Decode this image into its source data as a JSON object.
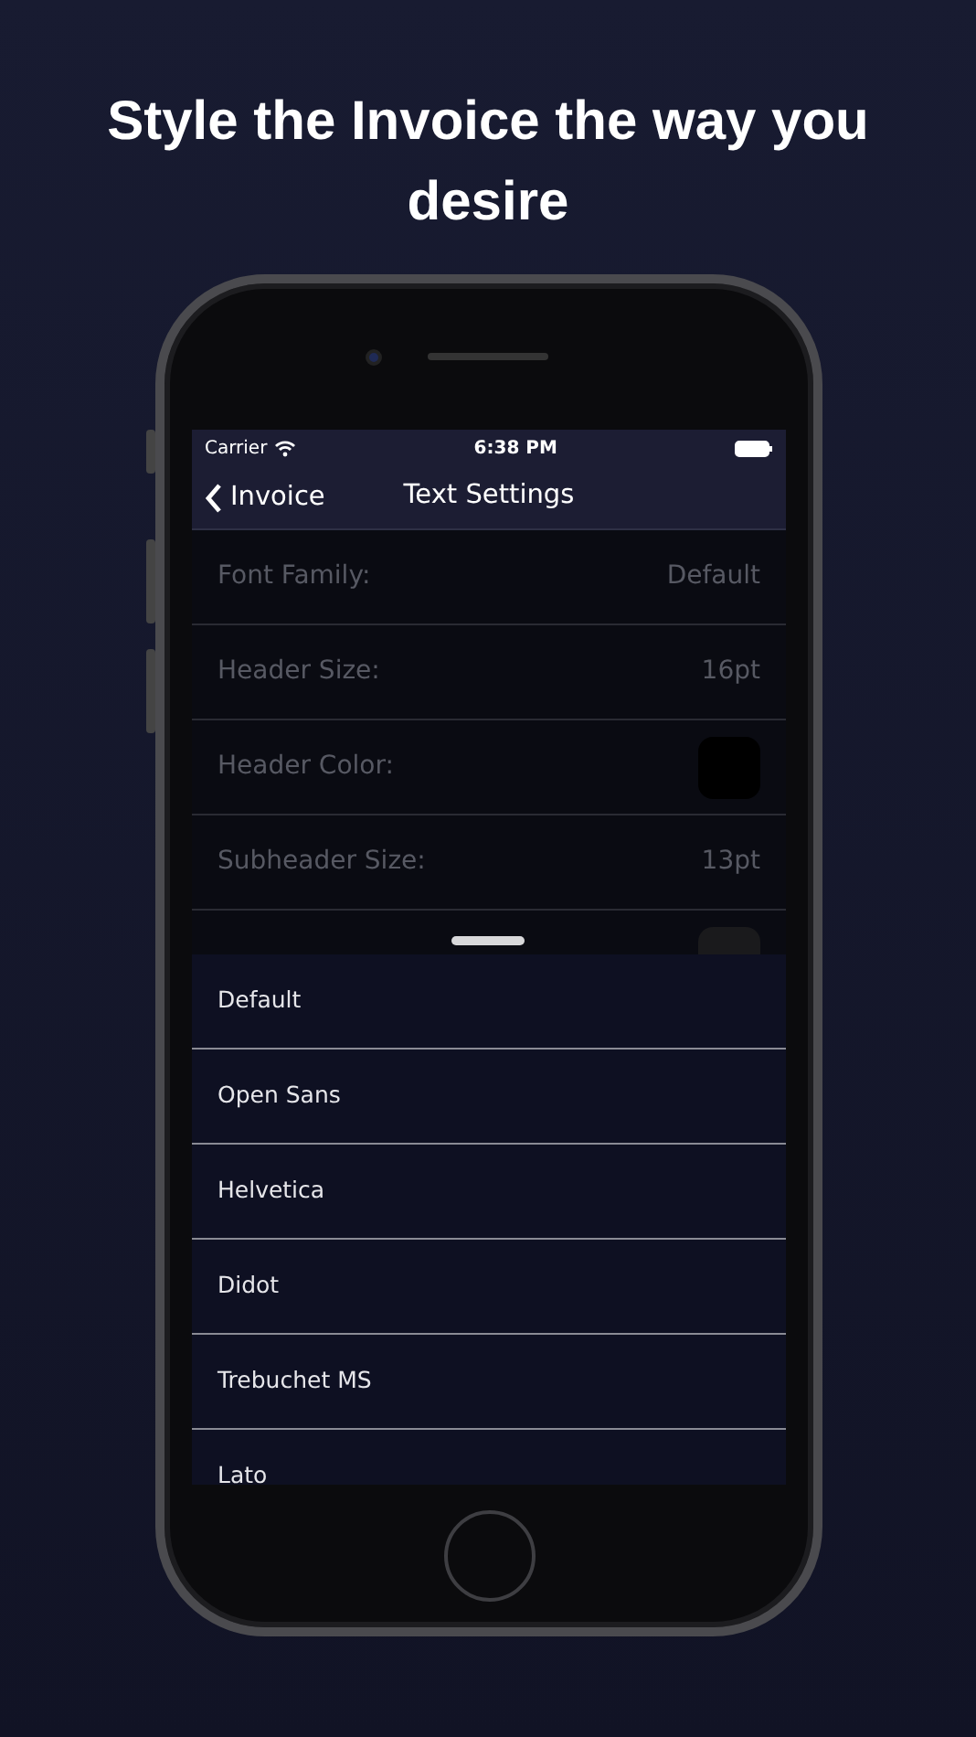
{
  "headline": "Style the Invoice the way you desire",
  "status_bar": {
    "carrier": "Carrier",
    "time": "6:38 PM"
  },
  "nav": {
    "back": "Invoice",
    "title": "Text Settings"
  },
  "settings": [
    {
      "kind": "value",
      "label": "Font Family:",
      "value": "Default"
    },
    {
      "kind": "value",
      "label": "Header Size:",
      "value": "16pt"
    },
    {
      "kind": "color",
      "label": "Header Color:",
      "color": "#000000"
    },
    {
      "kind": "value",
      "label": "Subheader Size:",
      "value": "13pt"
    },
    {
      "kind": "color",
      "color": "#1a1a1c"
    }
  ],
  "font_options": [
    "Default",
    "Open Sans",
    "Helvetica",
    "Didot",
    "Trebuchet MS",
    "Lato"
  ]
}
